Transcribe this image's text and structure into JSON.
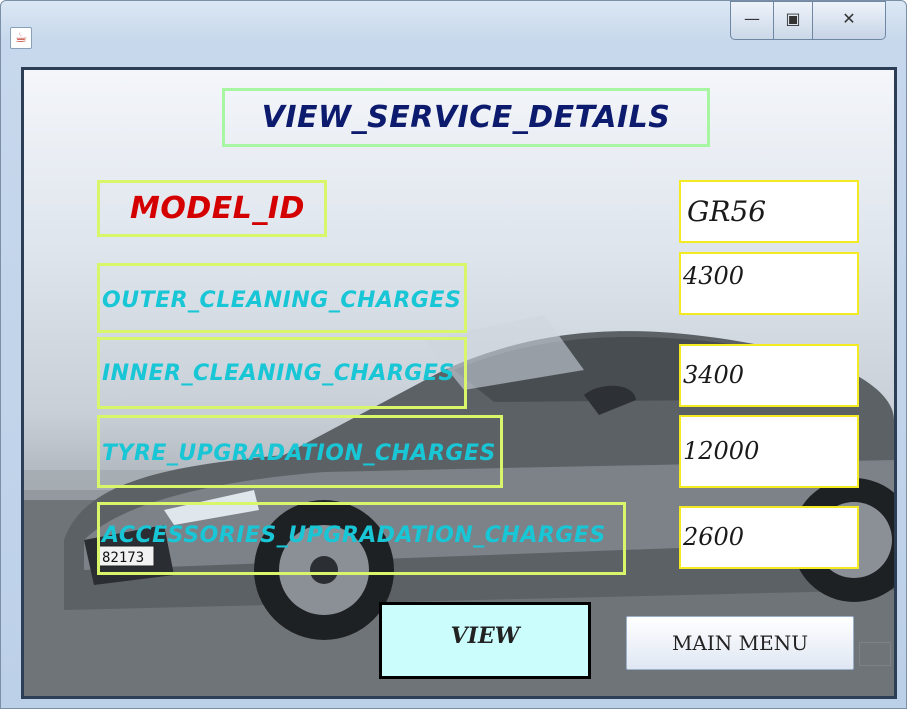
{
  "window": {
    "icon": "java-cup-icon"
  },
  "controls": {
    "minimize_glyph": "—",
    "maximize_glyph": "▣",
    "close_glyph": "✕"
  },
  "form": {
    "title": "VIEW_SERVICE_DETAILS",
    "model_label": "MODEL_ID",
    "outer_label": "OUTER_CLEANING_CHARGES",
    "inner_label": "INNER_CLEANING_CHARGES",
    "tyre_label": "TYRE_UPGRADATION_CHARGES",
    "acc_label": "ACCESSORIES_UPGRADATION_CHARGES"
  },
  "values": {
    "model_id": "GR56",
    "outer": "4300",
    "inner": "3400",
    "tyre": "12000",
    "acc": "2600"
  },
  "plate": "82173",
  "buttons": {
    "view": "VIEW",
    "main_menu": "MAIN MENU"
  }
}
